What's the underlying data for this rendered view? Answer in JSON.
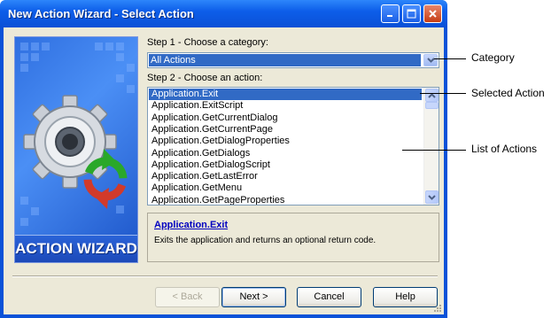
{
  "window": {
    "title": "New Action Wizard - Select Action",
    "controls": [
      "minimize-icon",
      "maximize-icon",
      "close-icon"
    ]
  },
  "banner": {
    "label": "ACTION WIZARD",
    "icon": "gear-icon"
  },
  "step1": {
    "label": "Step 1 - Choose a category:",
    "selected": "All Actions"
  },
  "step2": {
    "label": "Step 2 - Choose an action:"
  },
  "actions": [
    {
      "label": "Application.Exit",
      "selected": true
    },
    {
      "label": "Application.ExitScript",
      "selected": false
    },
    {
      "label": "Application.GetCurrentDialog",
      "selected": false
    },
    {
      "label": "Application.GetCurrentPage",
      "selected": false
    },
    {
      "label": "Application.GetDialogProperties",
      "selected": false
    },
    {
      "label": "Application.GetDialogs",
      "selected": false
    },
    {
      "label": "Application.GetDialogScript",
      "selected": false
    },
    {
      "label": "Application.GetLastError",
      "selected": false
    },
    {
      "label": "Application.GetMenu",
      "selected": false
    },
    {
      "label": "Application.GetPageProperties",
      "selected": false
    }
  ],
  "description": {
    "title": "Application.Exit",
    "text": "Exits the application and returns an optional return code."
  },
  "buttons": {
    "back": "< Back",
    "next": "Next >",
    "cancel": "Cancel",
    "help": "Help"
  },
  "callouts": {
    "category": "Category",
    "selected_action": "Selected Action",
    "list_of_actions": "List of Actions"
  },
  "colors": {
    "title_bar": "#0a52d8",
    "selection": "#316ac5",
    "dialog_face": "#ece9d8",
    "link": "#0000c0"
  }
}
